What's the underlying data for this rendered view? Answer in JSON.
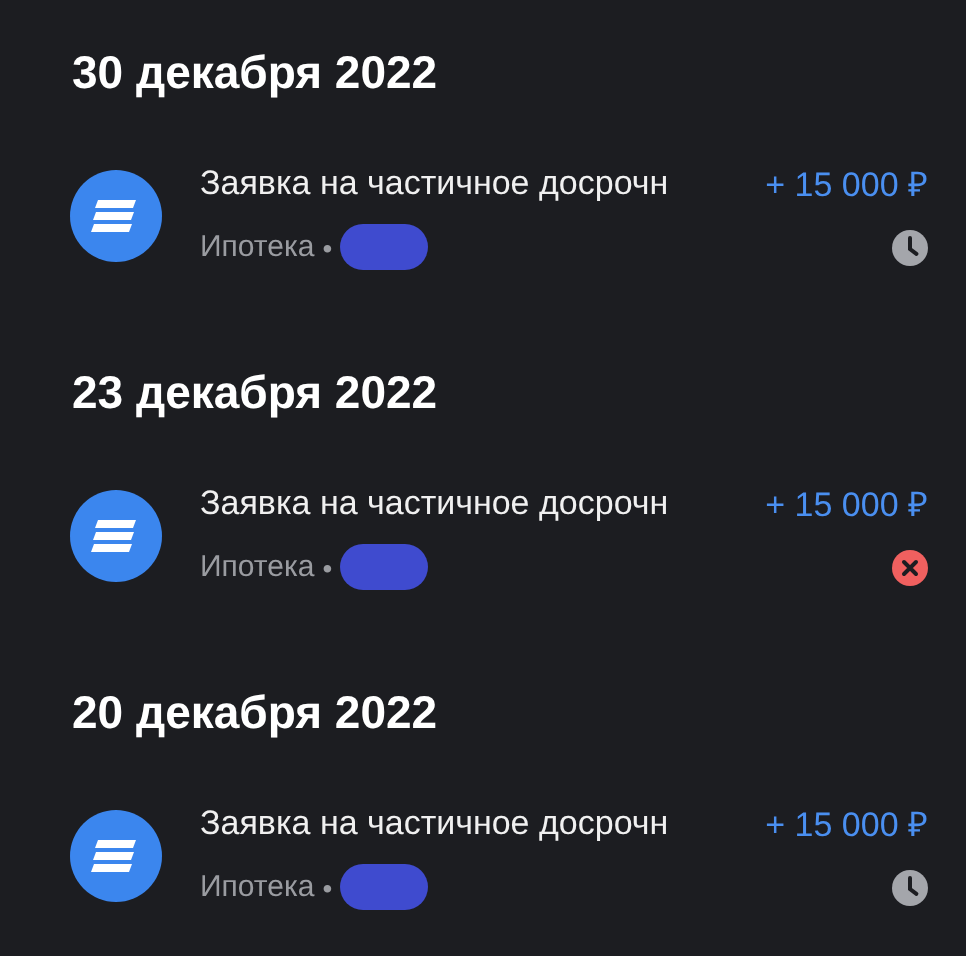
{
  "groups": [
    {
      "date": "30 декабря 2022",
      "operations": [
        {
          "title": "Заявка на частичное досрочн",
          "amount": "+ 15 000 ₽",
          "category": "Ипотека",
          "separator": "•",
          "kind": "pending"
        }
      ]
    },
    {
      "date": "23 декабря 2022",
      "operations": [
        {
          "title": "Заявка на частичное досрочн",
          "amount": "+ 15 000 ₽",
          "category": "Ипотека",
          "separator": "•",
          "kind": "rejected"
        }
      ]
    },
    {
      "date": "20 декабря 2022",
      "operations": [
        {
          "title": "Заявка на частичное досрочн",
          "amount": "+ 15 000 ₽",
          "category": "Ипотека",
          "separator": "•",
          "kind": "pending"
        }
      ]
    }
  ]
}
